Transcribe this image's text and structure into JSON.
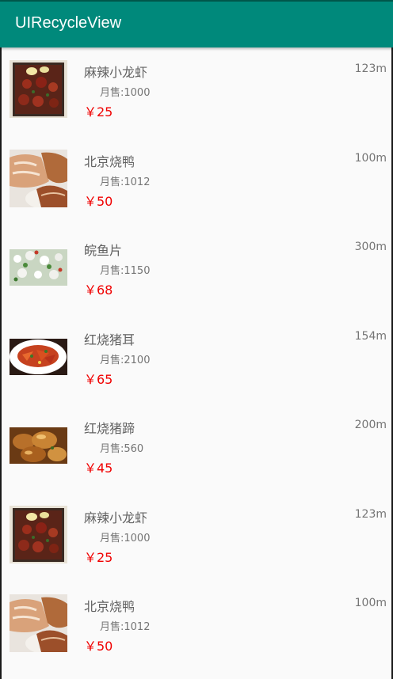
{
  "app": {
    "title": "UIRecycleView"
  },
  "items": [
    {
      "name": "麻辣小龙虾",
      "sales": "月售:1000",
      "price": "￥25",
      "distance": "123m",
      "image": "crayfish-image"
    },
    {
      "name": "北京烧鸭",
      "sales": "月售:1012",
      "price": "￥50",
      "distance": "100m",
      "image": "roast-duck-image"
    },
    {
      "name": "皖鱼片",
      "sales": "月售:1150",
      "price": "￥68",
      "distance": "300m",
      "image": "fish-slices-image"
    },
    {
      "name": "红烧猪耳",
      "sales": "月售:2100",
      "price": "￥65",
      "distance": "154m",
      "image": "braised-pig-ear-image"
    },
    {
      "name": "红烧猪蹄",
      "sales": "月售:560",
      "price": "￥45",
      "distance": "200m",
      "image": "braised-trotter-image"
    },
    {
      "name": "麻辣小龙虾",
      "sales": "月售:1000",
      "price": "￥25",
      "distance": "123m",
      "image": "crayfish-image"
    },
    {
      "name": "北京烧鸭",
      "sales": "月售:1012",
      "price": "￥50",
      "distance": "100m",
      "image": "roast-duck-image"
    }
  ],
  "colors": {
    "appbar": "#00897b",
    "price": "#f00000",
    "text": "#616161"
  }
}
